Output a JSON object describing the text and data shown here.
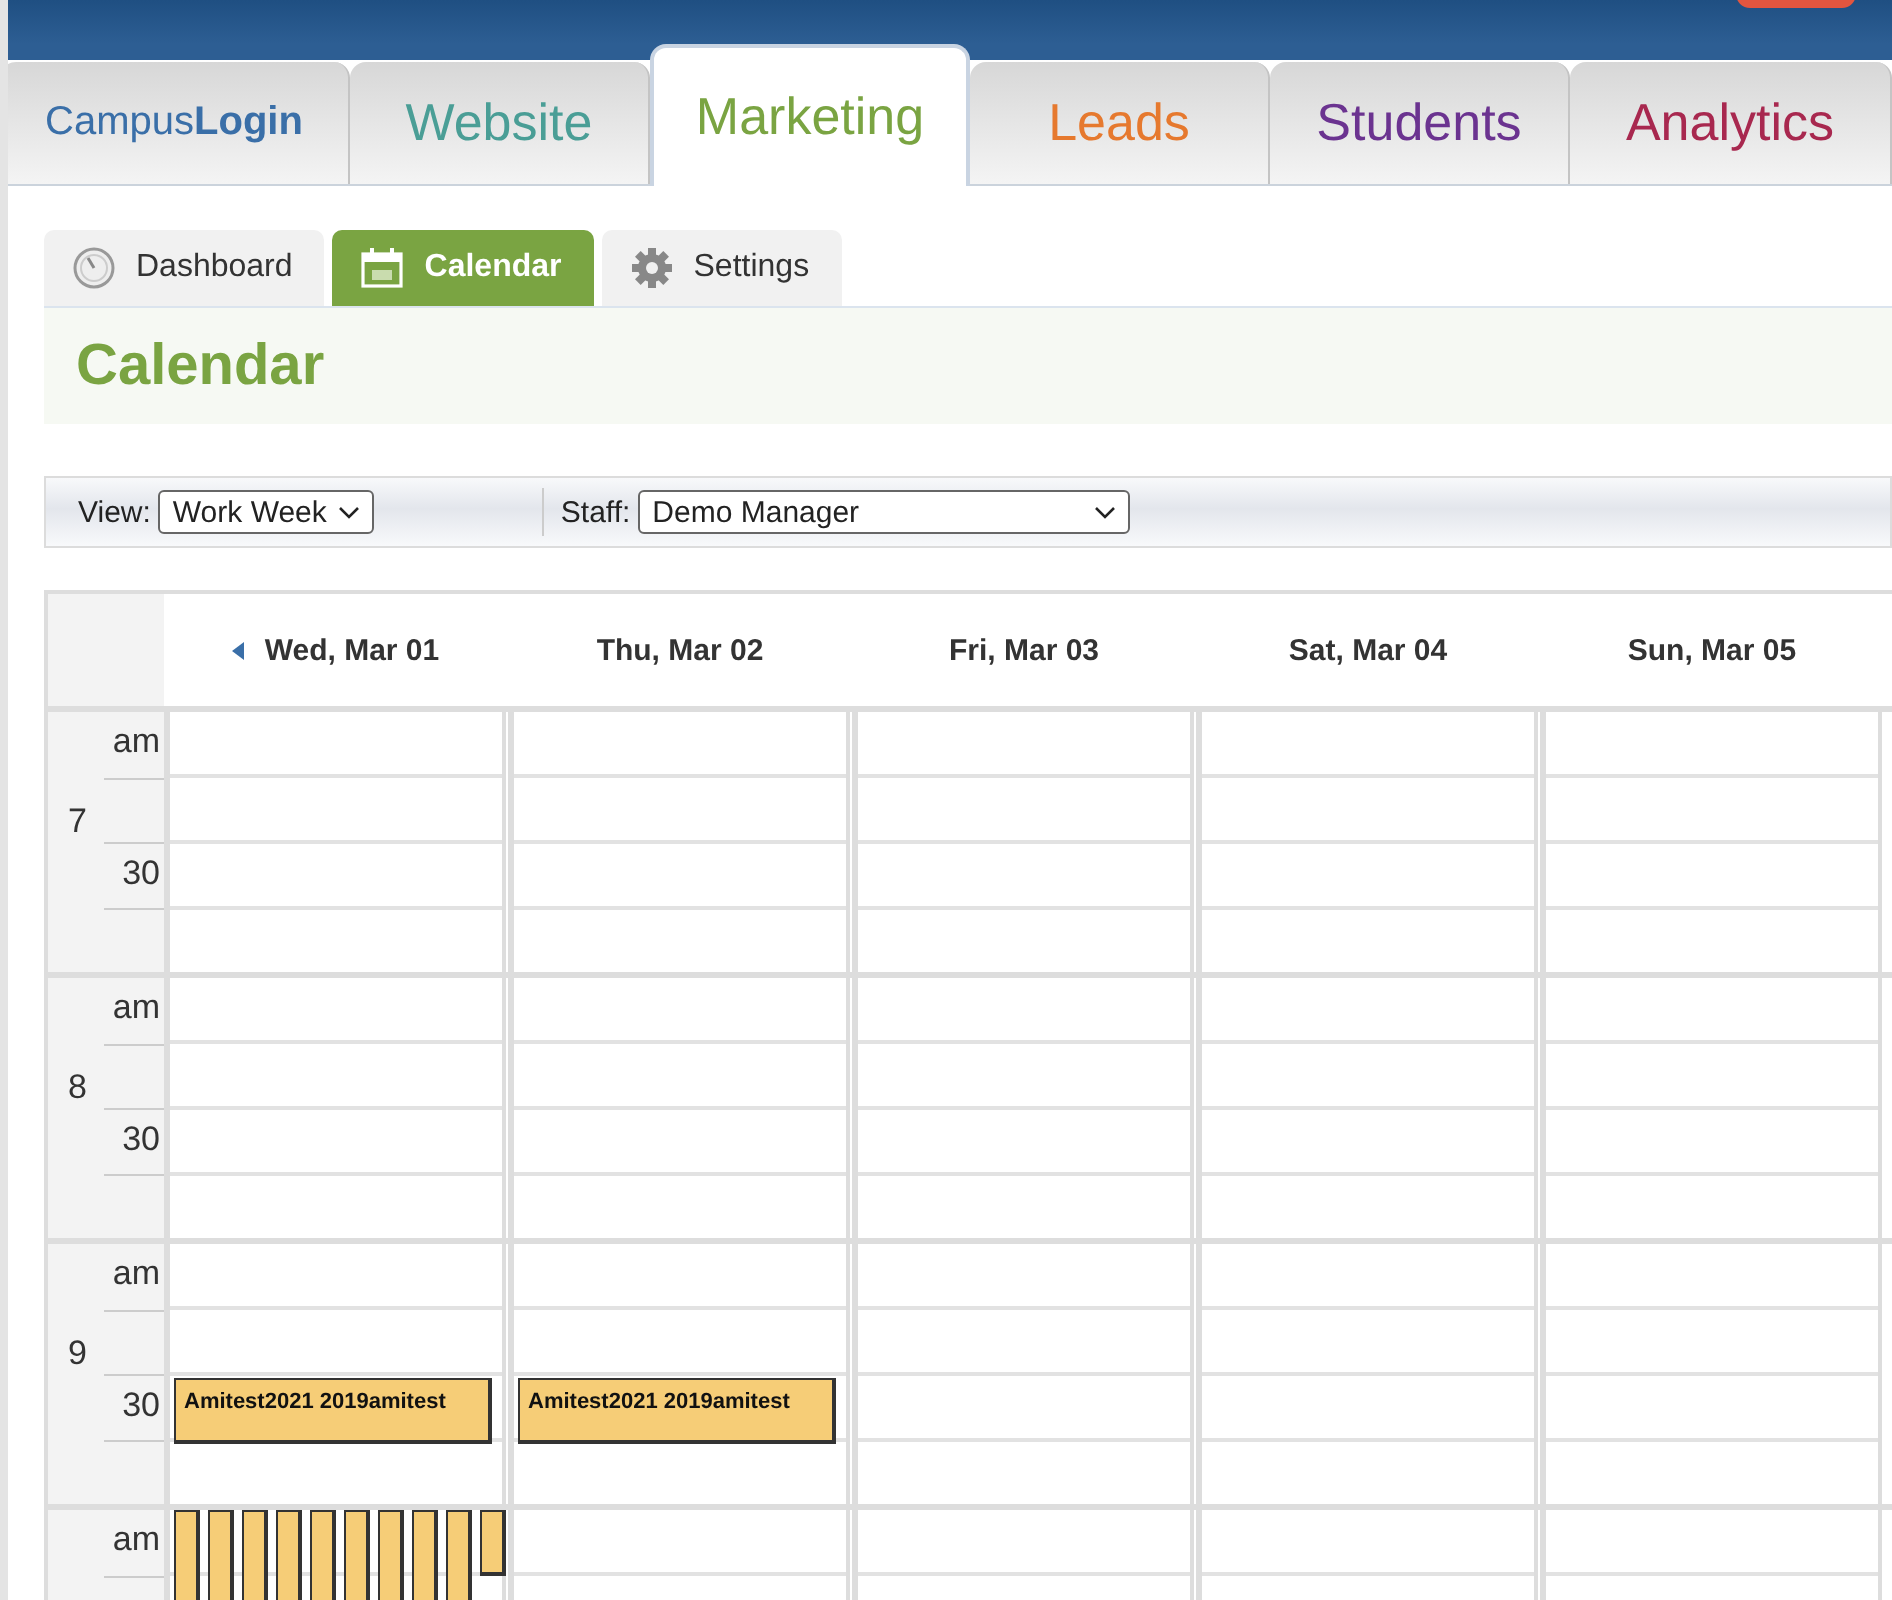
{
  "main_tabs": [
    {
      "kind": "logo",
      "label": "Campus**Login**",
      "color": "#3a6fa8",
      "selected": false
    },
    {
      "kind": "tab",
      "label": "Website",
      "color": "#4a9e96",
      "selected": false
    },
    {
      "kind": "tab",
      "label": "Marketing",
      "color": "#7aa442",
      "selected": true
    },
    {
      "kind": "tab",
      "label": "Leads",
      "color": "#e6792e",
      "selected": false
    },
    {
      "kind": "tab",
      "label": "Students",
      "color": "#6b3390",
      "selected": false
    },
    {
      "kind": "tab",
      "label": "Analytics",
      "color": "#a8284f",
      "selected": false
    }
  ],
  "sub_tabs": [
    {
      "kind": "dashboard",
      "label": "Dashboard",
      "selected": false
    },
    {
      "kind": "calendar",
      "label": "Calendar",
      "selected": true
    },
    {
      "kind": "settings",
      "label": "Settings",
      "selected": false
    }
  ],
  "page_title": "Calendar",
  "toolbar": {
    "view_label": "View:",
    "view_value": "Work Week",
    "staff_label": "Staff:",
    "staff_value": "Demo Manager"
  },
  "calendar": {
    "hours": [
      {
        "hour": "7",
        "am": "am",
        "half": "30"
      },
      {
        "hour": "8",
        "am": "am",
        "half": "30"
      },
      {
        "hour": "9",
        "am": "am",
        "half": "30"
      },
      {
        "am": "am"
      }
    ],
    "days": [
      {
        "label": "Wed, Mar 01",
        "events": [
          {
            "kind": "full",
            "title": "Amitest2021 2019amitest"
          },
          {
            "kind": "mini",
            "short": false
          },
          {
            "kind": "mini",
            "short": false
          },
          {
            "kind": "mini",
            "short": false
          },
          {
            "kind": "mini",
            "short": false
          },
          {
            "kind": "mini",
            "short": false
          },
          {
            "kind": "mini",
            "short": false
          },
          {
            "kind": "mini",
            "short": false
          },
          {
            "kind": "mini",
            "short": false
          },
          {
            "kind": "mini",
            "short": false
          },
          {
            "kind": "mini",
            "short": true
          }
        ]
      },
      {
        "label": "Thu, Mar 02",
        "events": [
          {
            "kind": "full",
            "title": "Amitest2021 2019amitest"
          }
        ]
      },
      {
        "label": "Fri, Mar 03"
      },
      {
        "label": "Sat, Mar 04"
      },
      {
        "label": "Sun, Mar 05"
      }
    ]
  }
}
